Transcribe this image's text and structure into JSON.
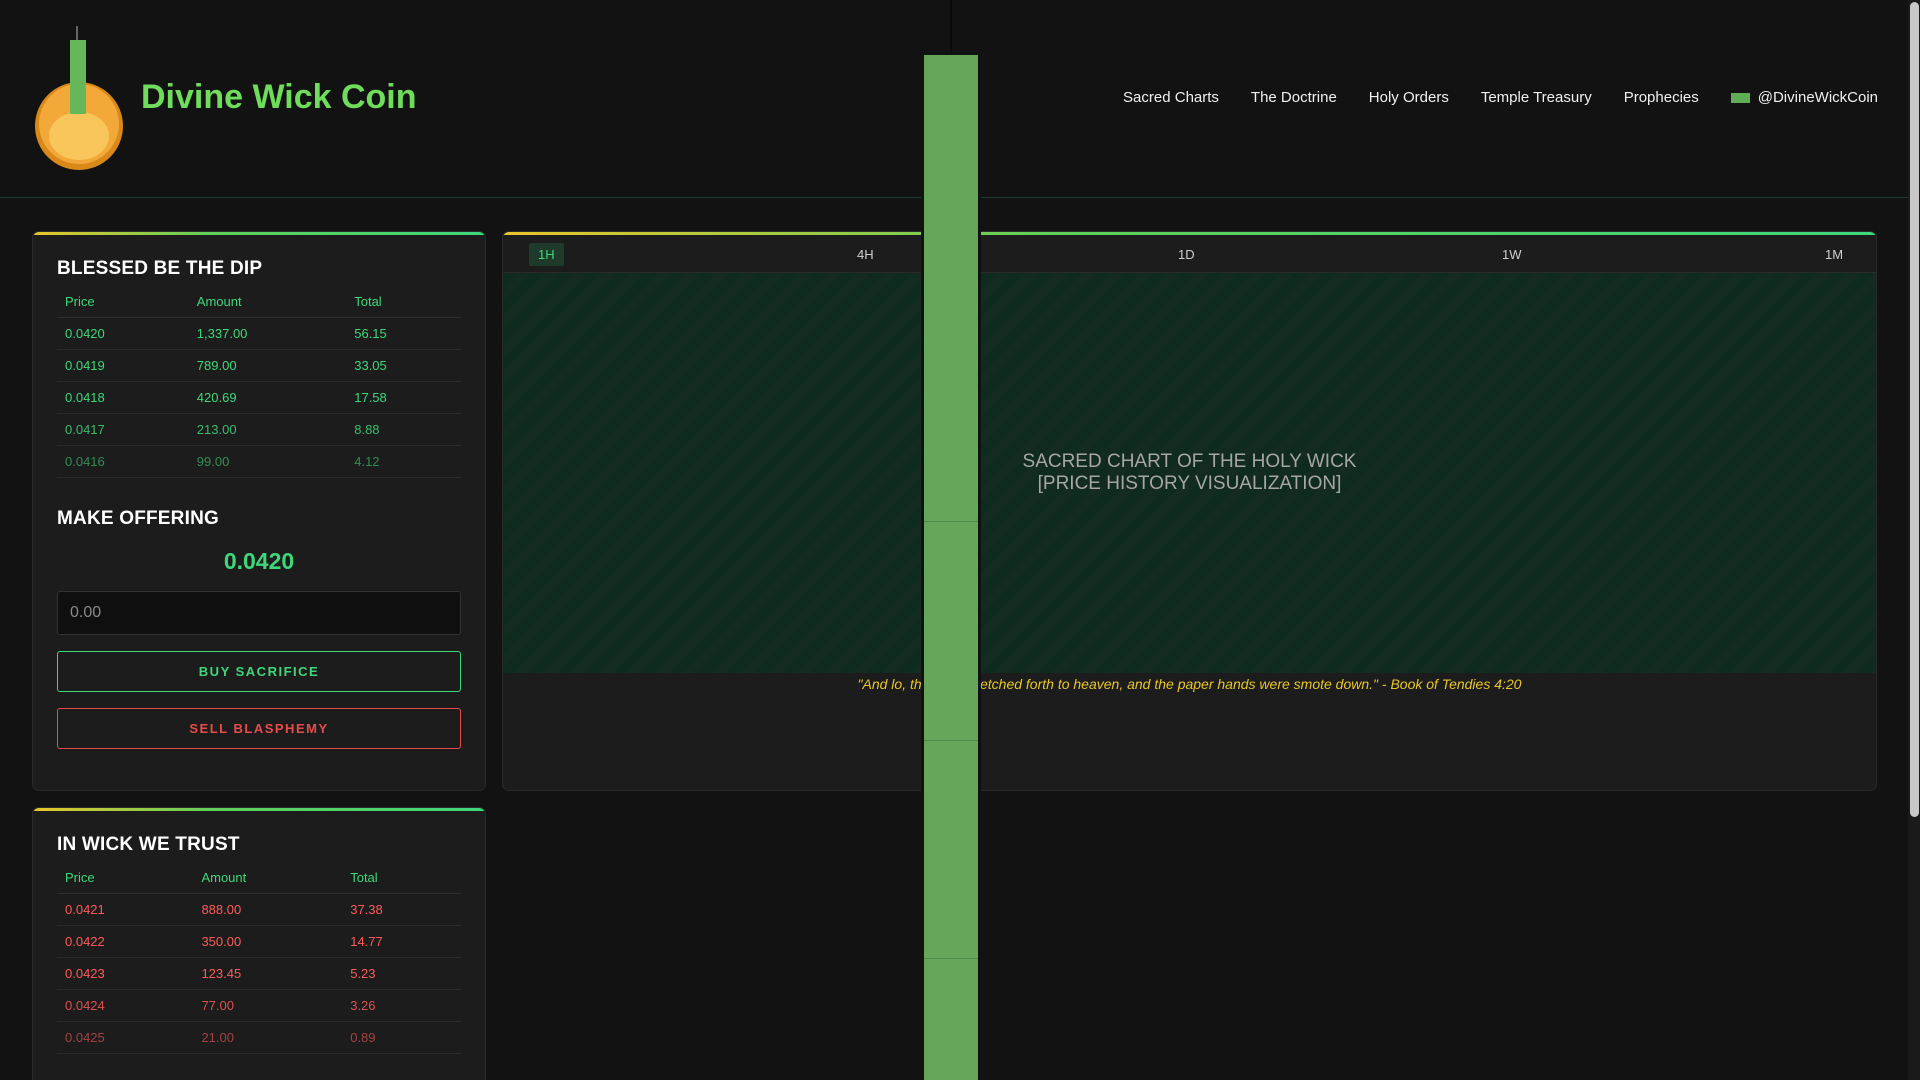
{
  "header": {
    "brand_name": "Divine Wick Coin",
    "nav": [
      "Sacred Charts",
      "The Doctrine",
      "Holy Orders",
      "Temple Treasury",
      "Prophecies"
    ],
    "social_handle": "@DivineWickCoin"
  },
  "buy_book": {
    "title": "BLESSED BE THE DIP",
    "columns": [
      "Price",
      "Amount",
      "Total"
    ],
    "rows": [
      [
        "0.0420",
        "1,337.00",
        "56.15"
      ],
      [
        "0.0419",
        "789.00",
        "33.05"
      ],
      [
        "0.0418",
        "420.69",
        "17.58"
      ],
      [
        "0.0417",
        "213.00",
        "8.88"
      ],
      [
        "0.0416",
        "99.00",
        "4.12"
      ]
    ]
  },
  "offer": {
    "title": "MAKE OFFERING",
    "price": "0.0420",
    "amount_placeholder": "0.00",
    "buy_label": "BUY SACRIFICE",
    "sell_label": "SELL BLASPHEMY"
  },
  "sell_book": {
    "title": "IN WICK WE TRUST",
    "columns": [
      "Price",
      "Amount",
      "Total"
    ],
    "rows": [
      [
        "0.0421",
        "888.00",
        "37.38"
      ],
      [
        "0.0422",
        "350.00",
        "14.77"
      ],
      [
        "0.0423",
        "123.45",
        "5.23"
      ],
      [
        "0.0424",
        "77.00",
        "3.26"
      ],
      [
        "0.0425",
        "21.00",
        "0.89"
      ]
    ]
  },
  "chart": {
    "tabs": [
      "1H",
      "4H",
      "1D",
      "1W",
      "1M"
    ],
    "active_tab": "1H",
    "placeholder_line1": "SACRED CHART OF THE HOLY WICK",
    "placeholder_line2": "[PRICE HISTORY VISUALIZATION]",
    "quote": "\"And lo, the wick stretched forth to heaven, and the paper hands were smote down.\" - Book of Tendies 4:20"
  },
  "colors": {
    "accent_green": "#3fd77a",
    "brand_green": "#6fdc5b",
    "sell_red": "#ff5a5a",
    "gold": "#e8c62a",
    "candle_green": "#66a65a"
  }
}
